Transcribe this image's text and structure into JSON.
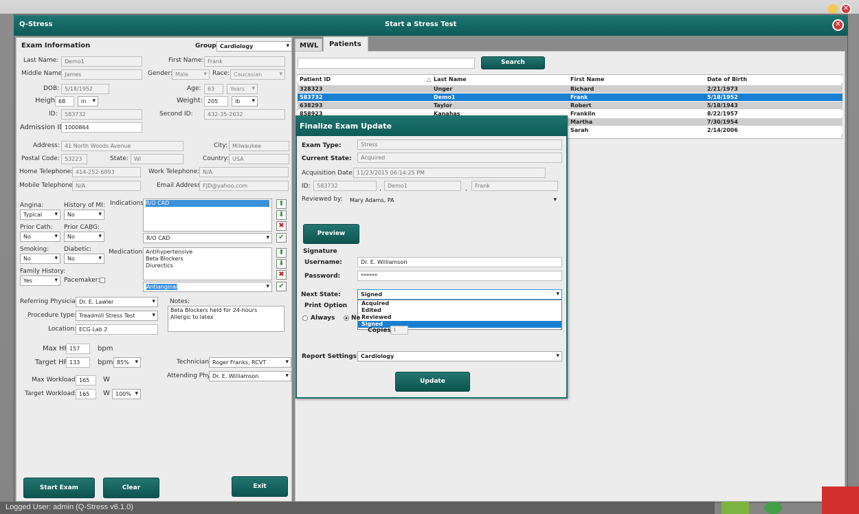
{
  "window": {
    "app_name": "Q-Stress",
    "title": "Start a Stress Test"
  },
  "exam": {
    "header": "Exam Information",
    "group_label": "Group",
    "group_value": "Cardiology",
    "last_name_label": "Last Name:",
    "last_name": "Demo1",
    "first_name_label": "First Name:",
    "first_name": "Frank",
    "middle_name_label": "Middle Name:",
    "middle_name": "James",
    "gender_label": "Gender:",
    "gender": "Male",
    "race_label": "Race:",
    "race": "Caucasian",
    "dob_label": "DOB:",
    "dob": "5/18/1952",
    "age_label": "Age:",
    "age": "63",
    "age_unit": "Years",
    "height_label": "Height:",
    "height": "68",
    "height_unit": "in",
    "weight_label": "Weight:",
    "weight": "205",
    "weight_unit": "lb",
    "id_label": "ID:",
    "id": "583732",
    "second_id_label": "Second ID:",
    "second_id": "432-35-2632",
    "admission_label": "Admission ID:",
    "admission_id": "1000864",
    "address_label": "Address:",
    "address": "41 North Woods Avenue",
    "city_label": "City:",
    "city": "Milwaukee",
    "postal_label": "Postal Code:",
    "postal": "53223",
    "state_label": "State:",
    "state": "WI",
    "country_label": "Country:",
    "country": "USA",
    "home_tel_label": "Home Telephone:",
    "home_tel": "414-252-6893",
    "work_tel_label": "Work Telephone:",
    "work_tel": "N/A",
    "mobile_label": "Mobile Telephone:",
    "mobile": "N/A",
    "email_label": "Email Address:",
    "email": "FJD@yahoo.com",
    "angina_label": "Angina:",
    "angina": "Typical",
    "history_mi_label": "History of MI:",
    "history_mi": "No",
    "prior_cath_label": "Prior Cath:",
    "prior_cath": "No",
    "prior_cabg_label": "Prior CABG:",
    "prior_cabg": "No",
    "smoking_label": "Smoking:",
    "smoking": "No",
    "diabetic_label": "Diabetic:",
    "diabetic": "No",
    "family_label": "Family History:",
    "family": "Yes",
    "pacemaker_label": "Pacemaker:",
    "indications_label": "Indications:",
    "indications_items": [
      "R/O CAD"
    ],
    "indications_select": "R/O CAD",
    "medications_label": "Medications:",
    "medications_items": [
      "Antihypertensive",
      "Beta Blockers",
      "Diurectics"
    ],
    "medications_select": "Antianginal",
    "referring_label": "Referring Physician:",
    "referring": "Dr. E. Lawler",
    "procedure_label": "Procedure type:",
    "procedure": "Treadmill Stress Test",
    "location_label": "Location:",
    "location": "ECG Lab 2",
    "notes_label": "Notes:",
    "notes_line1": "Beta Blockers held for 24-hours",
    "notes_line2": "Allergic to latex",
    "maxhr_label": "Max HR:",
    "maxhr": "157",
    "bpm": "bpm",
    "targethr_label": "Target HR:",
    "targethr": "133",
    "targethr_pct": "85%",
    "maxwl_label": "Max Workload:",
    "maxwl": "165",
    "w_unit": "W",
    "targetwl_label": "Target Workload:",
    "targetwl": "165",
    "targetwl_pct": "100%",
    "technician_label": "Technician:",
    "technician": "Roger Franks, RCVT",
    "attending_label": "Attending Phy:",
    "attending": "Dr. E. Williamson",
    "start_button": "Start Exam",
    "clear_button": "Clear",
    "exit_button": "Exit"
  },
  "tabs": {
    "mwl": "MWL",
    "patients": "Patients"
  },
  "search_button": "Search",
  "patients_table": {
    "headers": [
      "Patient ID",
      "Last Name",
      "First Name",
      "Date of Birth"
    ],
    "rows": [
      [
        "328323",
        "Unger",
        "Richard",
        "2/21/1973"
      ],
      [
        "583732",
        "Demo1",
        "Frank",
        "5/18/1952"
      ],
      [
        "638293",
        "Taylor",
        "Robert",
        "5/18/1943"
      ],
      [
        "858923",
        "Kanahas",
        "Franklin",
        "8/22/1957"
      ],
      [
        "",
        "",
        "Martha",
        "7/30/1954"
      ],
      [
        "",
        "",
        "Sarah",
        "2/14/2006"
      ]
    ]
  },
  "finalize": {
    "title": "Finalize Exam Update",
    "exam_type_label": "Exam Type:",
    "exam_type": "Stress",
    "current_state_label": "Current State:",
    "current_state": "Acquired",
    "acq_date_label": "Acquisition Date:",
    "acq_date": "11/23/2015 06:14:25 PM",
    "id_label": "ID:",
    "id": "583732",
    "last": "Demo1",
    "first": "Frank",
    "comma": ",",
    "reviewed_label": "Reviewed by:",
    "reviewed": "Mary Adams, PA",
    "preview_button": "Preview",
    "signature_label": "Signature",
    "username_label": "Username:",
    "username": "Dr. E. Williamson",
    "password_label": "Password:",
    "password": "******",
    "next_state_label": "Next State:",
    "next_state": "Signed",
    "next_state_options": [
      "Acquired",
      "Edited",
      "Reviewed",
      "Signed"
    ],
    "print_option_label": "Print Option",
    "always_label": "Always",
    "never_label": "Ne",
    "copies_label": "Copies",
    "copies": "1",
    "report_settings_label": "Report Settings",
    "report_settings": "Cardiology",
    "update_button": "Update"
  },
  "status_bar": "Logged User: admin (Q-Stress v6.1.0)"
}
